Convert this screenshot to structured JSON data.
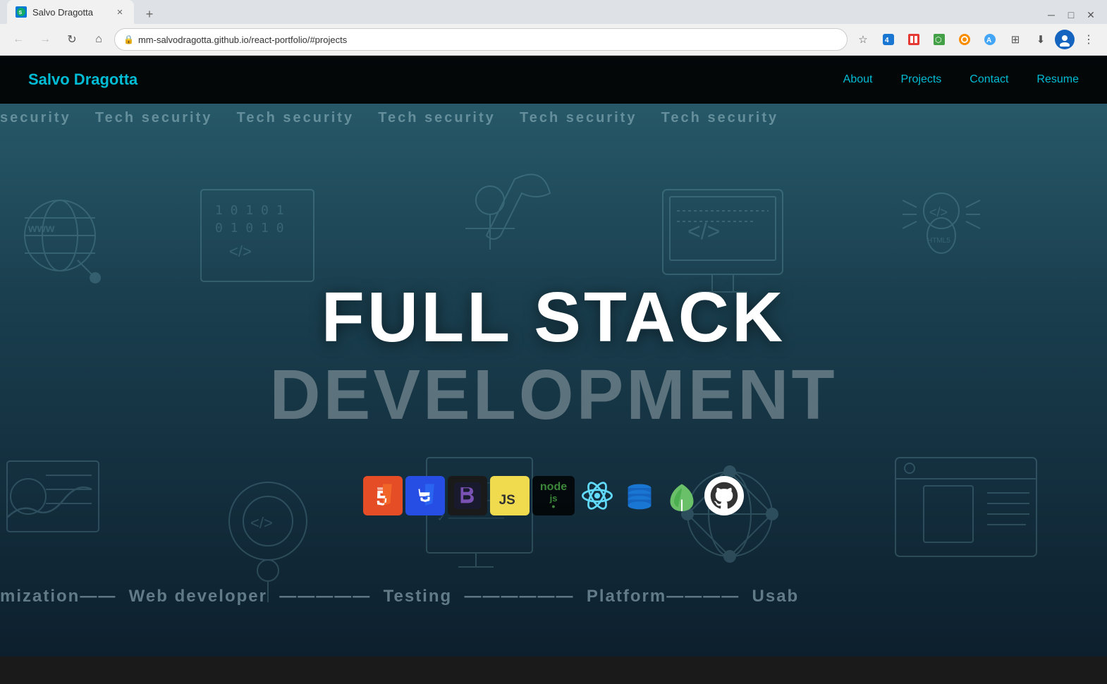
{
  "browser": {
    "tab_title": "Salvo Dragotta",
    "tab_favicon": "SD",
    "url": "mm-salvodragotta.github.io/react-portfolio/#projects",
    "back_btn": "←",
    "forward_btn": "→",
    "refresh_btn": "↺",
    "home_btn": "⌂",
    "new_tab_btn": "+"
  },
  "site": {
    "logo": "Salvo Dragotta",
    "nav": {
      "about": "About",
      "projects": "Projects",
      "contact": "Contact",
      "resume": "Resume"
    },
    "hero": {
      "line1": "FULL STACK",
      "line2": "DEVELOPMENT"
    },
    "marquee_top": "security----Tech security----Tech security----Tech security----Tech security",
    "marquee_bottom": "mization----Web developer----Testing--------Platform----Usab",
    "tech_badges": [
      {
        "id": "html5",
        "label": "HTML5"
      },
      {
        "id": "css3",
        "label": "CSS3"
      },
      {
        "id": "bootstrap",
        "label": "Bootstrap"
      },
      {
        "id": "js",
        "label": "JS"
      },
      {
        "id": "node",
        "label": "node"
      },
      {
        "id": "react",
        "label": "React"
      },
      {
        "id": "database",
        "label": "Database"
      },
      {
        "id": "leaf",
        "label": "Leaf"
      },
      {
        "id": "github",
        "label": "GitHub"
      }
    ]
  }
}
